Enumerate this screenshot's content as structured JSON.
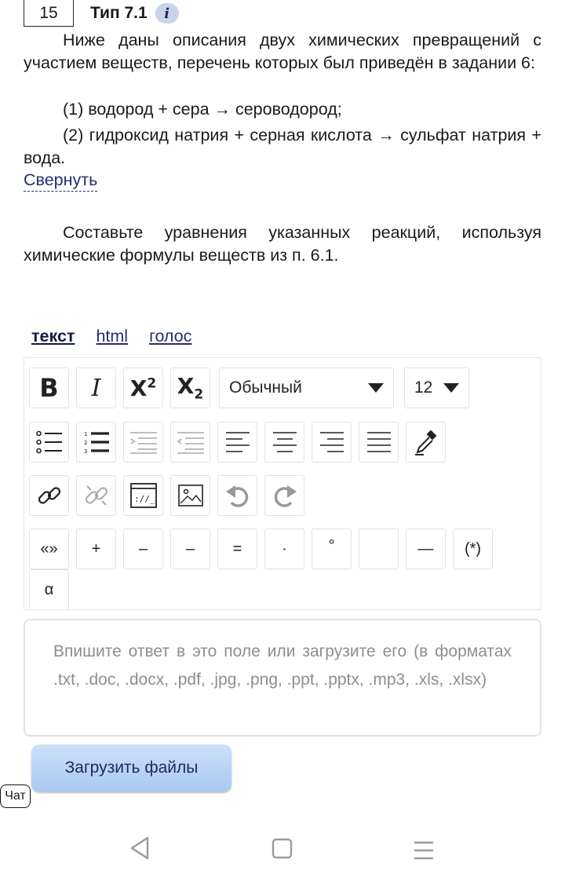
{
  "task": {
    "number": "15",
    "type_label": "Тип 7.1",
    "info_glyph": "i",
    "description": "Ниже даны описания двух химических превращений с участием веществ, перечень которых был приведён в задании 6:",
    "reaction1": "(1) водород + сера → сероводород;",
    "reaction2": "(2) гидроксид натрия + серная кислота → сульфат натрия + вода.",
    "collapse_link": "Свернуть",
    "instruction": "Составьте уравнения указанных реакций, используя химические формулы веществ из п. 6.1."
  },
  "mode_tabs": [
    "текст",
    "html",
    "голос"
  ],
  "active_mode": "текст",
  "toolbar": {
    "bold": "B",
    "italic": "I",
    "sup_base": "X",
    "sup_exp": "2",
    "sub_base": "X",
    "sub_idx": "2",
    "format_select": "Обычный",
    "size_select": "12",
    "symbols": [
      "«»",
      "+",
      "–",
      "–",
      "=",
      "·",
      "°",
      "",
      "—",
      "(*)",
      "α"
    ]
  },
  "answer_placeholder": "Впишите ответ в это поле или загрузите его (в форматах .txt, .doc, .docx, .pdf, .jpg, .png, .ppt, .pptx, .mp3, .xls, .xlsx)",
  "upload_button": "Загрузить файлы",
  "chat_button": "Чат",
  "colors": {
    "link": "#23306b",
    "upload_bg": "#b9d3f5",
    "placeholder": "#8e8e8e"
  }
}
